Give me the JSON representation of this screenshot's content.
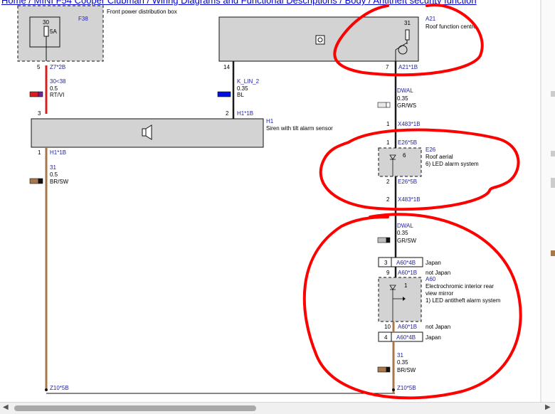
{
  "breadcrumb": "Home / MINI F54 Cooper Clubman / Wiring Diagrams and Functional Descriptions / Body / Antitheft security function",
  "components": {
    "f38": {
      "pin": "30",
      "fuse": "5A",
      "name": "F38",
      "desc": "Front power distribution box"
    },
    "a21": {
      "name": "A21",
      "desc": "Roof function centre",
      "pin": "31"
    },
    "h1": {
      "name": "H1",
      "desc": "Siren with tilt alarm sensor"
    },
    "e26": {
      "name": "E26",
      "desc": "Roof aerial",
      "note": "6)   LED alarm system",
      "inner": "6"
    },
    "a60": {
      "name": "A60",
      "desc1": "Electrochromic interior rear",
      "desc2": "view mirror",
      "note": "1)   LED antitheft alarm system",
      "inner": "1"
    }
  },
  "wires": {
    "w1": {
      "top_pin": "5",
      "top_conn": "Z7*2B",
      "signal": "30<38",
      "size": "0.5",
      "color": "RT/VI",
      "bottom_pin": "3"
    },
    "w2": {
      "top_pin": "14",
      "signal": "K_LIN_2",
      "size": "0.35",
      "color": "BL",
      "bottom_pin": "2",
      "bottom_conn": "H1*1B"
    },
    "w3": {
      "pin": "1",
      "conn": "H1*1B",
      "signal": "31",
      "size": "0.5",
      "color": "BR/SW",
      "ground": "Z10*5B"
    },
    "w4": {
      "pin": "7",
      "conn": "A21*1B",
      "signal": "DWAL",
      "size": "0.35",
      "color": "GR/WS"
    },
    "w5": {
      "pin_a": "1",
      "conn_a": "X483*1B",
      "pin_b": "1",
      "conn_b": "E26*5B",
      "pin_c": "2",
      "conn_c": "E26*5B",
      "pin_d": "2",
      "conn_d": "X483*1B"
    },
    "w6": {
      "signal": "DWAL",
      "size": "0.35",
      "color": "GR/SW"
    },
    "a60_top": {
      "box_pin": "3",
      "box_conn": "A60*4B",
      "box_note": "Japan",
      "pin": "9",
      "conn": "A60*1B",
      "note": "not Japan"
    },
    "a60_bot": {
      "pin": "10",
      "conn": "A60*1B",
      "note": "not Japan",
      "box_pin": "4",
      "box_conn": "A60*4B",
      "box_note": "Japan"
    },
    "w7": {
      "signal": "31",
      "size": "0.35",
      "color": "BR/SW",
      "ground": "Z10*5B"
    }
  },
  "colors": {
    "red_wire": "#d42020",
    "brown_wire": "#a9784a",
    "black_wire": "#1a1a1a",
    "blue_wire": "#0011dd",
    "annotation": "#ff0000",
    "component_fill": "#d3d3d3",
    "link_text": "#1f1fa0"
  }
}
